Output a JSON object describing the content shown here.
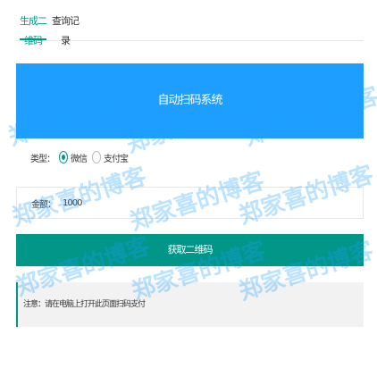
{
  "tabs": [
    {
      "label": "生成二维码",
      "active": true
    },
    {
      "label": "查询记录",
      "active": false
    }
  ],
  "banner": {
    "text": "自动扫码系统"
  },
  "radio": {
    "label": "类型：",
    "options": [
      {
        "label": "微信",
        "checked": true
      },
      {
        "label": "支付宝",
        "checked": false
      }
    ]
  },
  "input": {
    "label": "金额：",
    "value": "1000"
  },
  "main_button": {
    "label": "获取二维码"
  },
  "note": {
    "text": "注意：请在电脑上打开此页面扫码支付"
  },
  "watermark": {
    "text": "郑家喜的博客"
  },
  "colors": {
    "accent": "#009688",
    "banner": "#1e9fff",
    "watermark": "#1e9fff",
    "note_bg": "#f2f2f2"
  }
}
